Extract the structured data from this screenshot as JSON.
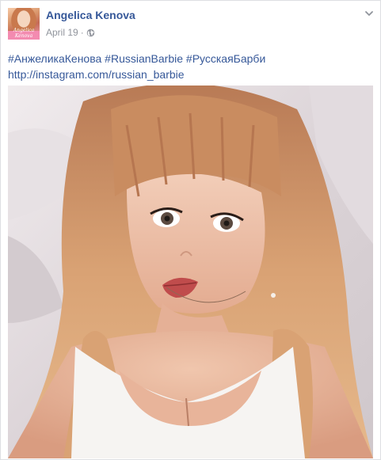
{
  "post": {
    "author": "Angelica Kenova",
    "date": "April 19",
    "separator": "·",
    "hashtags": [
      "#АнжеликаКенова",
      "#RussianBarbie",
      "#РусскаяБарби"
    ],
    "link": "http://instagram.com/russian_barbie",
    "avatar_text": "Angelica Kenova"
  },
  "icons": {
    "privacy": "globe-icon",
    "options": "chevron-down-icon"
  },
  "colors": {
    "link": "#365899",
    "text": "#1d2129",
    "meta": "#90949c"
  }
}
